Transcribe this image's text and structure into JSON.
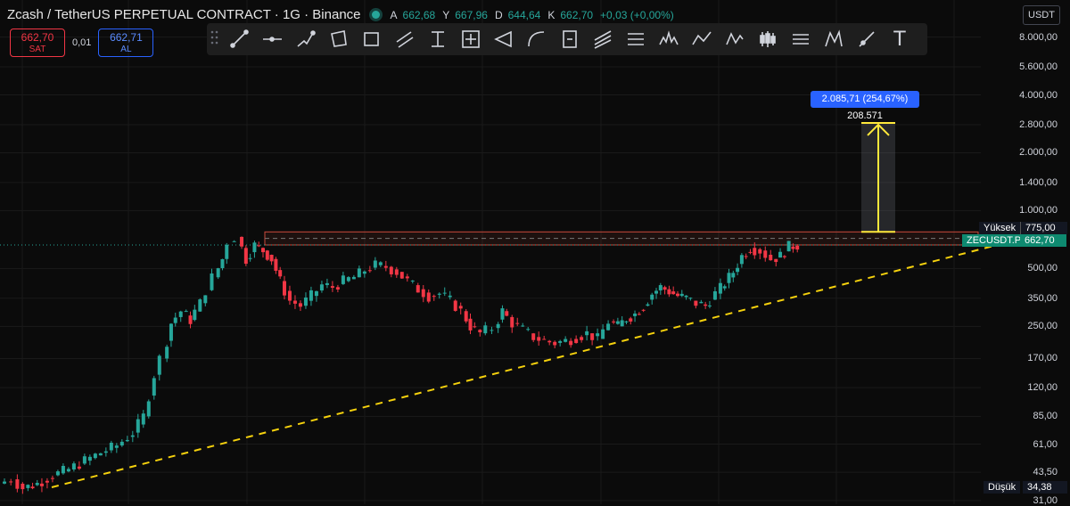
{
  "header": {
    "title": "Zcash / TetherUS PERPETUAL CONTRACT · 1G · Binance",
    "ohlc": [
      {
        "k": "A",
        "v": "662,68"
      },
      {
        "k": "Y",
        "v": "667,96"
      },
      {
        "k": "D",
        "v": "644,64"
      },
      {
        "k": "K",
        "v": "662,70"
      }
    ],
    "change": "+0,03 (+0,00%)"
  },
  "trade": {
    "sell_price": "662,70",
    "sell_label": "SAT",
    "spread": "0,01",
    "buy_price": "662,71",
    "buy_label": "AL"
  },
  "toolbar": {
    "tools": [
      "trend-line-icon",
      "horizontal-ray-icon",
      "path-icon",
      "polygon-icon",
      "rectangle-icon",
      "parallel-channel-icon",
      "price-range-icon",
      "date-price-range-icon",
      "pitchfork-icon",
      "arc-icon",
      "long-position-icon",
      "fib-channel-icon",
      "fib-timezone-icon",
      "head-shoulders-icon",
      "zigzag-icon",
      "pattern-icon",
      "candles-icon",
      "bars-pattern-icon",
      "xabcd-pattern-icon",
      "ray-icon",
      "text-tool-icon"
    ],
    "text_tool_glyph": "T"
  },
  "currency": "USDT",
  "measure_label": "2.085,71 (254,67%) 208.571",
  "tags": {
    "high_label": "Yüksek",
    "high_value": "775,00",
    "symbol_label": "ZECUSDT.P",
    "symbol_value": "662,70",
    "low_label": "Düşük",
    "low_value": "34,38"
  },
  "colors": {
    "up": "#26a69a",
    "down": "#f23645",
    "accent": "#2962ff",
    "trendline": "#f5d10d",
    "measure_arrow": "#ffe93b",
    "resistance": "#c94a3c"
  },
  "chart_data": {
    "type": "candlestick",
    "y_scale": "log",
    "y_ticks": [
      "8.000,00",
      "5.600,00",
      "4.000,00",
      "2.800,00",
      "2.000,00",
      "1.400,00",
      "1.000,00",
      "500,00",
      "350,00",
      "250,00",
      "170,00",
      "120,00",
      "85,00",
      "61,00",
      "43,50",
      "31,00"
    ],
    "y_tick_values": [
      8000,
      5600,
      4000,
      2800,
      2000,
      1400,
      1000,
      500,
      350,
      250,
      170,
      120,
      85,
      61,
      43.5,
      31
    ],
    "y_range": [
      30,
      8400
    ],
    "close_path": [
      [
        0,
        38
      ],
      [
        12,
        40
      ],
      [
        22,
        36
      ],
      [
        35,
        38
      ],
      [
        50,
        42
      ],
      [
        65,
        45
      ],
      [
        80,
        50
      ],
      [
        95,
        55
      ],
      [
        110,
        60
      ],
      [
        125,
        70
      ],
      [
        135,
        85
      ],
      [
        145,
        140
      ],
      [
        152,
        170
      ],
      [
        160,
        260
      ],
      [
        170,
        300
      ],
      [
        178,
        270
      ],
      [
        188,
        330
      ],
      [
        200,
        450
      ],
      [
        208,
        560
      ],
      [
        215,
        690
      ],
      [
        222,
        730
      ],
      [
        230,
        560
      ],
      [
        238,
        660
      ],
      [
        246,
        620
      ],
      [
        254,
        560
      ],
      [
        262,
        430
      ],
      [
        272,
        340
      ],
      [
        282,
        320
      ],
      [
        292,
        360
      ],
      [
        302,
        410
      ],
      [
        312,
        400
      ],
      [
        322,
        430
      ],
      [
        332,
        450
      ],
      [
        342,
        490
      ],
      [
        352,
        520
      ],
      [
        362,
        510
      ],
      [
        372,
        480
      ],
      [
        382,
        430
      ],
      [
        392,
        390
      ],
      [
        402,
        360
      ],
      [
        412,
        370
      ],
      [
        422,
        340
      ],
      [
        432,
        300
      ],
      [
        440,
        250
      ],
      [
        450,
        230
      ],
      [
        462,
        245
      ],
      [
        470,
        300
      ],
      [
        480,
        260
      ],
      [
        490,
        240
      ],
      [
        500,
        220
      ],
      [
        510,
        210
      ],
      [
        520,
        205
      ],
      [
        530,
        210
      ],
      [
        540,
        220
      ],
      [
        550,
        230
      ],
      [
        560,
        215
      ],
      [
        570,
        265
      ],
      [
        578,
        250
      ],
      [
        586,
        275
      ],
      [
        594,
        290
      ],
      [
        602,
        320
      ],
      [
        610,
        370
      ],
      [
        618,
        400
      ],
      [
        626,
        380
      ],
      [
        634,
        360
      ],
      [
        642,
        350
      ],
      [
        652,
        330
      ],
      [
        660,
        320
      ],
      [
        670,
        370
      ],
      [
        678,
        420
      ],
      [
        686,
        480
      ],
      [
        694,
        580
      ],
      [
        702,
        640
      ],
      [
        712,
        620
      ],
      [
        722,
        560
      ],
      [
        730,
        580
      ],
      [
        738,
        650
      ],
      [
        746,
        662.7
      ]
    ],
    "high": 775,
    "low": 34.38,
    "last": 662.7,
    "measure": {
      "from": 775,
      "to": 2860
    }
  }
}
